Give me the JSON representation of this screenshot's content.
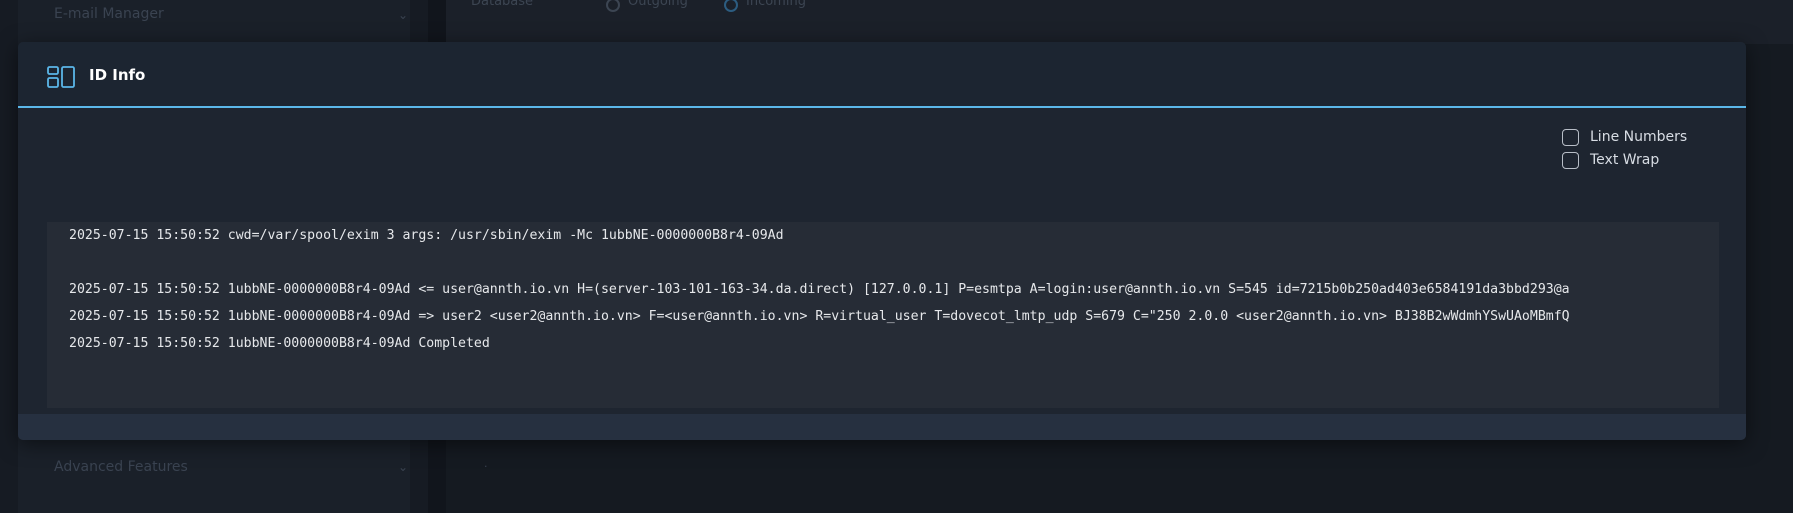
{
  "background": {
    "sidebar_items": [
      "E-mail Manager",
      "Advanced Features"
    ],
    "top_labels": [
      "Database",
      "Outgoing",
      "Incoming"
    ]
  },
  "modal": {
    "title": "ID Info",
    "icon": "layout-panels-icon",
    "options": [
      {
        "label": "Line Numbers",
        "checked": false
      },
      {
        "label": "Text Wrap",
        "checked": false
      }
    ],
    "log_lines": [
      "2025-07-15 15:50:52 cwd=/var/spool/exim 3 args: /usr/sbin/exim -Mc 1ubbNE-0000000B8r4-09Ad",
      "",
      "2025-07-15 15:50:52 1ubbNE-0000000B8r4-09Ad <= user@annth.io.vn H=(server-103-101-163-34.da.direct) [127.0.0.1] P=esmtpa A=login:user@annth.io.vn S=545 id=7215b0b250ad403e6584191da3bbd293@a",
      "2025-07-15 15:50:52 1ubbNE-0000000B8r4-09Ad => user2 <user2@annth.io.vn> F=<user@annth.io.vn> R=virtual_user T=dovecot_lmtp_udp S=679 C=\"250 2.0.0 <user2@annth.io.vn> BJ38B2wWdmhYSwUAoMBmfQ",
      "2025-07-15 15:50:52 1ubbNE-0000000B8r4-09Ad Completed"
    ],
    "horizontal_scroll_fraction": 0.75,
    "accent_color": "#5bb7e9"
  }
}
